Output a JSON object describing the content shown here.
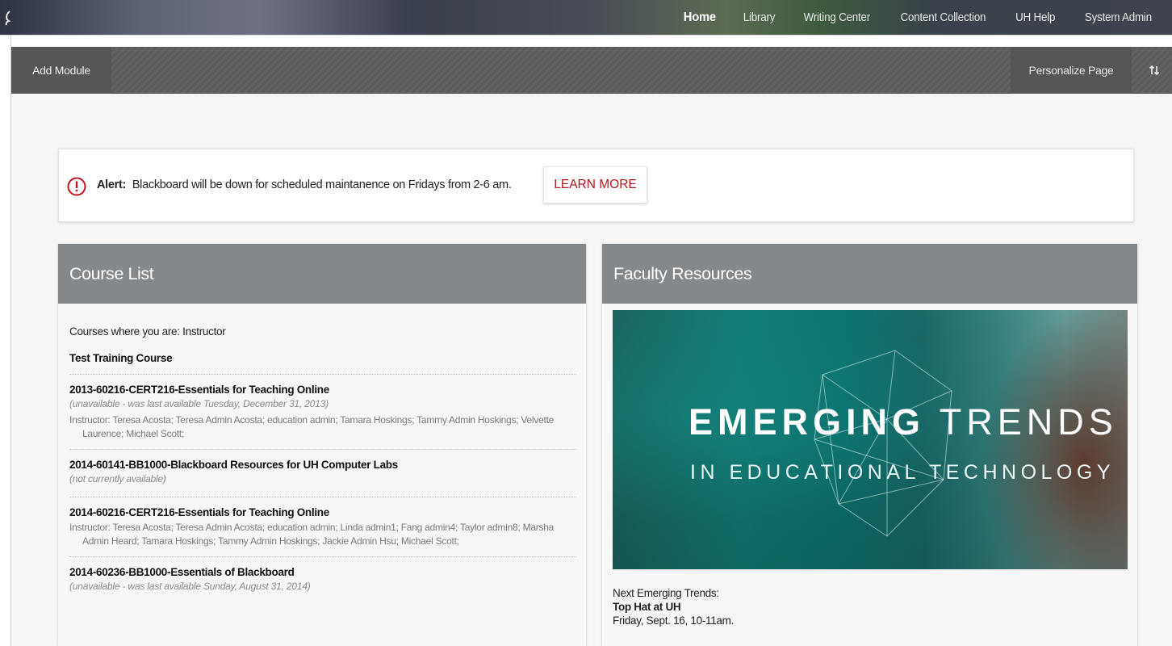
{
  "topnav": {
    "tabs": [
      {
        "label": "Home",
        "active": true
      },
      {
        "label": "Library",
        "active": false
      },
      {
        "label": "Writing Center",
        "active": false
      },
      {
        "label": "Content Collection",
        "active": false
      },
      {
        "label": "UH Help",
        "active": false
      },
      {
        "label": "System Admin",
        "active": false
      }
    ]
  },
  "module_bar": {
    "add_module_label": "Add Module",
    "personalize_label": "Personalize Page",
    "sort_icon": "sort-arrows-icon"
  },
  "alert": {
    "icon": "exclamation-circle-icon",
    "prefix": "Alert:",
    "message": "Blackboard will be down for scheduled maintanence on Fridays from 2-6 am.",
    "button_label": "LEARN MORE",
    "accent_color": "#b3161f"
  },
  "course_list": {
    "title": "Course List",
    "role_text": "Courses where you are: Instructor",
    "courses": [
      {
        "title": "Test Training Course",
        "status": "",
        "instructors": ""
      },
      {
        "title": "2013-60216-CERT216-Essentials for Teaching Online",
        "status": "(unavailable - was last available Tuesday, December 31, 2013)",
        "instructors": "Instructor: Teresa Acosta;  Teresa Admin Acosta;  education admin;  Tamara Hoskings;  Tammy Admin Hoskings;  Velvette Laurence;  Michael Scott;"
      },
      {
        "title": "2014-60141-BB1000-Blackboard Resources for UH Computer Labs",
        "status": "(not currently available)",
        "instructors": ""
      },
      {
        "title": "2014-60216-CERT216-Essentials for Teaching Online",
        "status": "",
        "instructors": "Instructor: Teresa Acosta;  Teresa Admin Acosta;  education admin;  Linda admin1;  Fang admin4;  Taylor admin8;  Marsha Admin Heard;  Tamara Hoskings;  Tammy Admin Hoskings;  Jackie Admin Hsu;  Michael Scott;"
      },
      {
        "title": "2014-60236-BB1000-Essentials of Blackboard",
        "status": "(unavailable - was last available Sunday, August 31, 2014)",
        "instructors": ""
      }
    ]
  },
  "faculty_resources": {
    "title": "Faculty Resources",
    "banner": {
      "line1_bold": "EMERGING",
      "line1_light": "TRENDS",
      "line2": "IN EDUCATIONAL TECHNOLOGY"
    },
    "next_label": "Next Emerging Trends:",
    "event_title": "Top Hat at UH",
    "event_time": "Friday, Sept. 16, 10-11am."
  }
}
